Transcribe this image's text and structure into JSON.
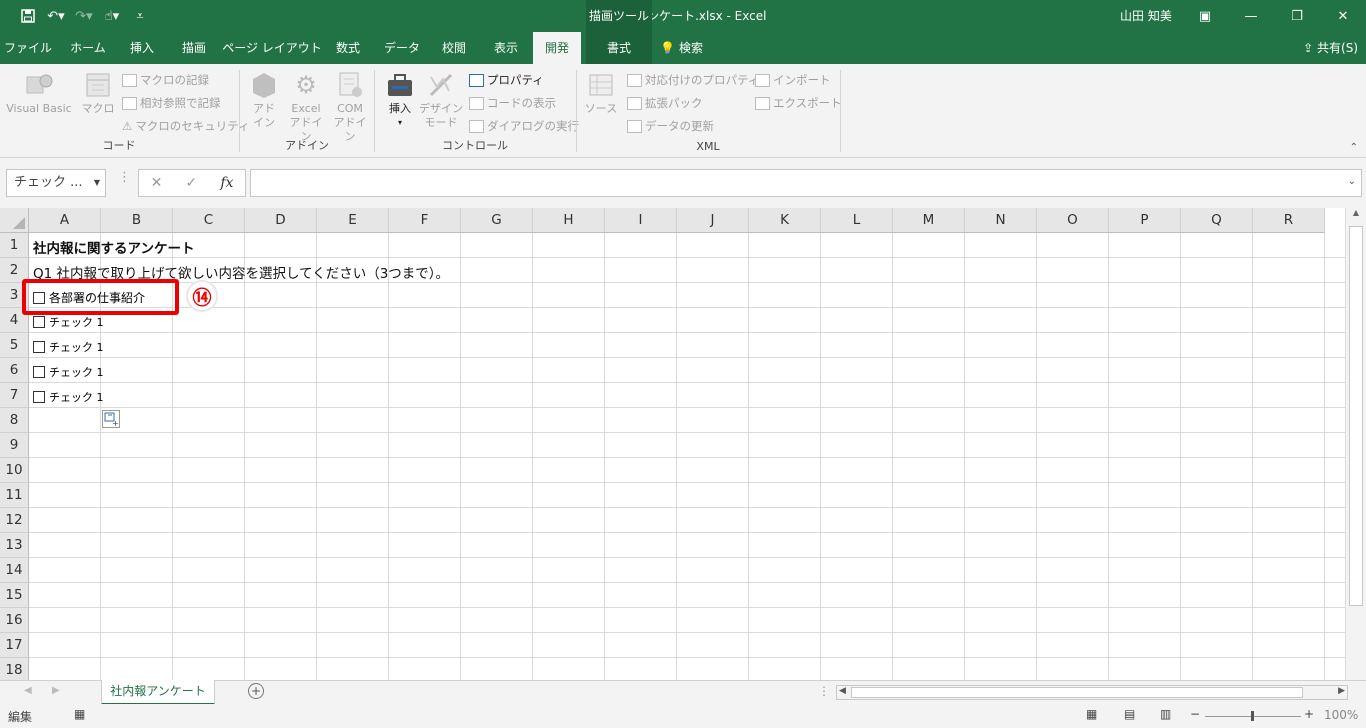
{
  "titlebar": {
    "title": "社内報アンケート.xlsx  -  Excel",
    "drawing_tools": "描画ツール",
    "user": "山田 知美"
  },
  "tabs": [
    "ファイル",
    "ホーム",
    "挿入",
    "描画",
    "ページ レイアウト",
    "数式",
    "データ",
    "校閲",
    "表示",
    "開発",
    "書式"
  ],
  "search_label": "検索",
  "share_label": "共有(S)",
  "ribbon": {
    "code_group": {
      "label": "コード",
      "visual_basic": "Visual Basic",
      "macro": "マクロ",
      "record_macro": "マクロの記録",
      "relative_ref": "相対参照で記録",
      "macro_security": "マクロのセキュリティ"
    },
    "addin_group": {
      "label": "アドイン",
      "addin_line1": "アド",
      "addin_line2": "イン",
      "excel_addin_line1": "Excel",
      "excel_addin_line2": "アドイン",
      "com_addin_line1": "COM",
      "com_addin_line2": "アドイン"
    },
    "control_group": {
      "label": "コントロール",
      "insert": "挿入",
      "design_line1": "デザイン",
      "design_line2": "モード",
      "properties": "プロパティ",
      "view_code": "コードの表示",
      "dialog": "ダイアログの実行"
    },
    "xml_group": {
      "label": "XML",
      "source": "ソース",
      "map_props": "対応付けのプロパティ",
      "expansion": "拡張パック",
      "refresh": "データの更新",
      "import": "インポート",
      "export": "エクスポート"
    }
  },
  "formula": {
    "name_box": "チェック ...",
    "fx": "fx",
    "value": ""
  },
  "columns": [
    "A",
    "B",
    "C",
    "D",
    "E",
    "F",
    "G",
    "H",
    "I",
    "J",
    "K",
    "L",
    "M",
    "N",
    "O",
    "P",
    "Q",
    "R"
  ],
  "rows": [
    "1",
    "2",
    "3",
    "4",
    "5",
    "6",
    "7",
    "8",
    "9",
    "10",
    "11",
    "12",
    "13",
    "14",
    "15",
    "16",
    "17",
    "18"
  ],
  "cells": {
    "a1": "社内報に関するアンケート",
    "a2": "Q1 社内報で取り上げて欲しい内容を選択してください（3つまで）。"
  },
  "checkboxes": [
    "各部署の仕事紹介",
    "チェック 1",
    "チェック 1",
    "チェック 1",
    "チェック 1"
  ],
  "annotation_badge": "⑭",
  "sheet_tab": "社内報アンケート",
  "status": {
    "mode": "編集",
    "zoom": "100%"
  }
}
